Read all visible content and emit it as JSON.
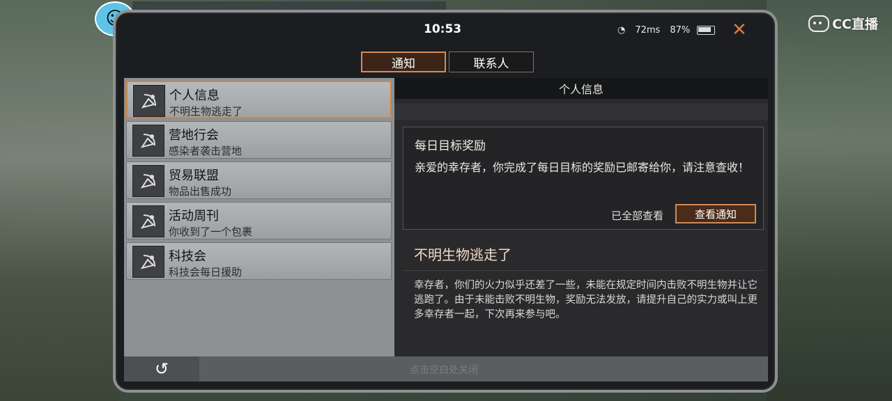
{
  "overlay": {
    "stream_logo": "CC直播"
  },
  "status": {
    "time": "10:53",
    "ping": "72ms",
    "battery": "87%"
  },
  "tabs": [
    {
      "label": "通知",
      "active": true
    },
    {
      "label": "联系人",
      "active": false
    }
  ],
  "list": {
    "items": [
      {
        "title": "个人信息",
        "subtitle": "不明生物逃走了",
        "active": true
      },
      {
        "title": "营地行会",
        "subtitle": "感染者袭击营地",
        "active": false
      },
      {
        "title": "贸易联盟",
        "subtitle": "物品出售成功",
        "active": false
      },
      {
        "title": "活动周刊",
        "subtitle": "你收到了一个包裹",
        "active": false
      },
      {
        "title": "科技会",
        "subtitle": "科技会每日援助",
        "active": false
      }
    ]
  },
  "detail": {
    "header": "个人信息",
    "card": {
      "title": "每日目标奖励",
      "body": "亲爱的幸存者，你完成了每日目标的奖励已邮寄给你，请注意查收！",
      "read_all": "已全部查看",
      "view_button": "查看通知"
    },
    "section_title": "不明生物逃走了",
    "section_body": "幸存者，你们的火力似乎还差了一些，未能在规定时间内击败不明生物并让它逃跑了。由于未能击败不明生物，奖励无法发放，请提升自己的实力或叫上更多幸存者一起，下次再来参与吧。"
  },
  "bottom": {
    "hint": "点击空白处关闭"
  },
  "colors": {
    "accent": "#d98c53",
    "close": "#d47a44"
  }
}
